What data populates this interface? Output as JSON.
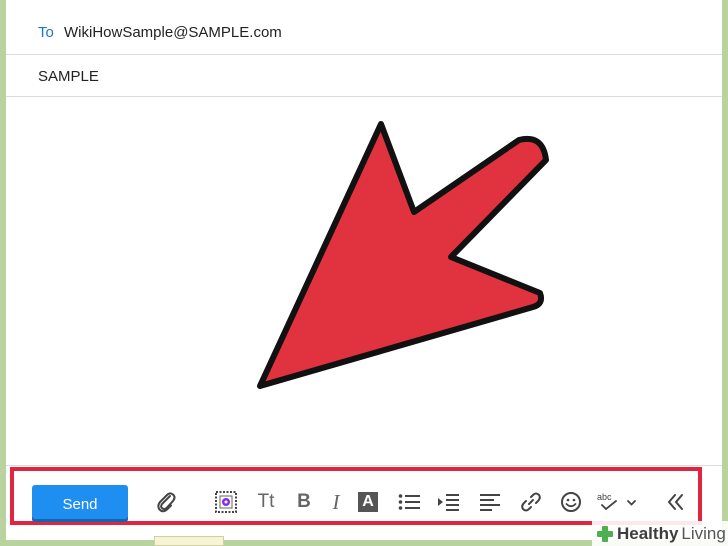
{
  "compose": {
    "to_label": "To",
    "to_value": "WikiHowSample@SAMPLE.com",
    "subject_value": "SAMPLE"
  },
  "toolbar": {
    "send_label": "Send",
    "text_size_label": "Tt",
    "bold_label": "B",
    "italic_label": "I",
    "font_color_label": "A",
    "icons": [
      "attach-icon",
      "stationery-icon",
      "text-size-icon",
      "bold-icon",
      "italic-icon",
      "font-color-icon",
      "bullet-list-icon",
      "indent-icon",
      "align-icon",
      "link-icon",
      "emoji-icon",
      "spellcheck-icon",
      "collapse-icon"
    ]
  },
  "annotation": {
    "arrow_color": "#e0323f",
    "highlight_color": "#e1253e"
  },
  "watermark": {
    "bold": "Healthy",
    "light": "Living",
    "accent_color": "#4caf50"
  },
  "colors": {
    "accent": "#1f8ef1",
    "to_label": "#1c76c9",
    "background": "#b8d39e"
  }
}
